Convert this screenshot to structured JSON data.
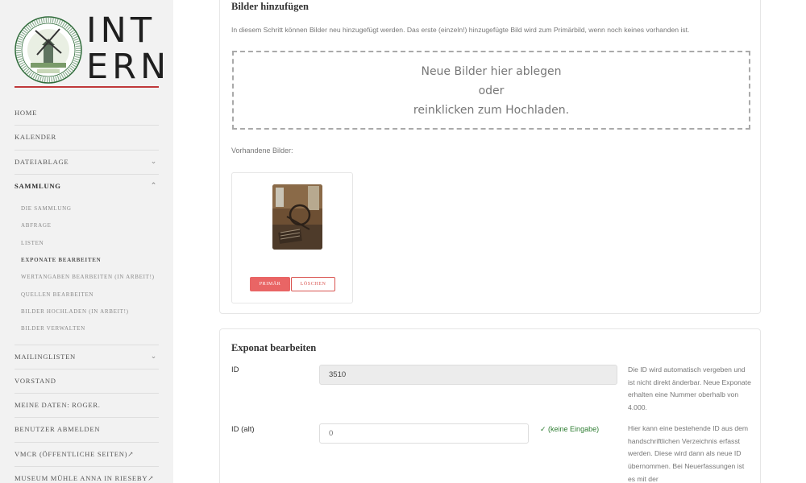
{
  "logo": {
    "word_line1": "INT",
    "word_line2": "ERN",
    "seal_text": "VEREIN FÜR MUSEUMS- UND CHRONIKARBEIT IN RIESEBY E.V."
  },
  "sidebar": {
    "items": [
      {
        "label": "HOME"
      },
      {
        "label": "KALENDER"
      },
      {
        "label": "DATEIABLAGE",
        "chevron": "⌄"
      },
      {
        "label": "SAMMLUNG",
        "chevron": "⌃"
      },
      {
        "label": "MAILINGLISTEN",
        "chevron": "⌄"
      },
      {
        "label": "VORSTAND"
      },
      {
        "label": "MEINE DATEN: ROGER."
      },
      {
        "label": "BENUTZER ABMELDEN"
      },
      {
        "label": "VMCR (ÖFFENTLICHE SEITEN)↗"
      },
      {
        "label": "MUSEUM MÜHLE ANNA IN RIESEBY↗"
      }
    ],
    "sammlung_sub": [
      {
        "label": "DIE SAMMLUNG"
      },
      {
        "label": "ABFRAGE"
      },
      {
        "label": "LISTEN"
      },
      {
        "label": "EXPONATE BEARBEITEN"
      },
      {
        "label": "WERTANGABEN BEARBEITEN (IN ARBEIT!)"
      },
      {
        "label": "QUELLEN BEARBEITEN"
      },
      {
        "label": "BILDER HOCHLADEN (IN ARBEIT!)"
      },
      {
        "label": "BILDER VERWALTEN"
      }
    ]
  },
  "bilder": {
    "title": "Bilder hinzufügen",
    "hint": "In diesem Schritt können Bilder neu hinzugefügt werden. Das erste (einzeln!) hinzugefügte Bild wird zum Primärbild, wenn noch keines vorhanden ist.",
    "dropzone": [
      "Neue Bilder hier ablegen",
      "oder",
      "reinklicken zum Hochladen."
    ],
    "existing_label": "Vorhandene Bilder:",
    "primary_button": "PRIMÄR",
    "delete_button": "LÖSCHEN"
  },
  "exponat": {
    "title": "Exponat bearbeiten",
    "id_label": "ID",
    "id_value": "3510",
    "id_help": "Die ID wird automatisch vergeben und ist nicht direkt änderbar. Neue Exponate erhalten eine Nummer oberhalb von 4.000.",
    "idalt_label": "ID (alt)",
    "idalt_placeholder": "0",
    "idalt_status": "✓ (keine Eingabe)",
    "idalt_help": "Hier kann eine bestehende ID aus dem handschriftlichen Verzeichnis erfasst werden. Diese wird dann als neue ID übernommen. Bei Neuerfassungen ist es mit der"
  },
  "colors": {
    "accent_red": "#c0393b",
    "primary_button": "#e96565",
    "valid_green": "#2e7d32"
  }
}
